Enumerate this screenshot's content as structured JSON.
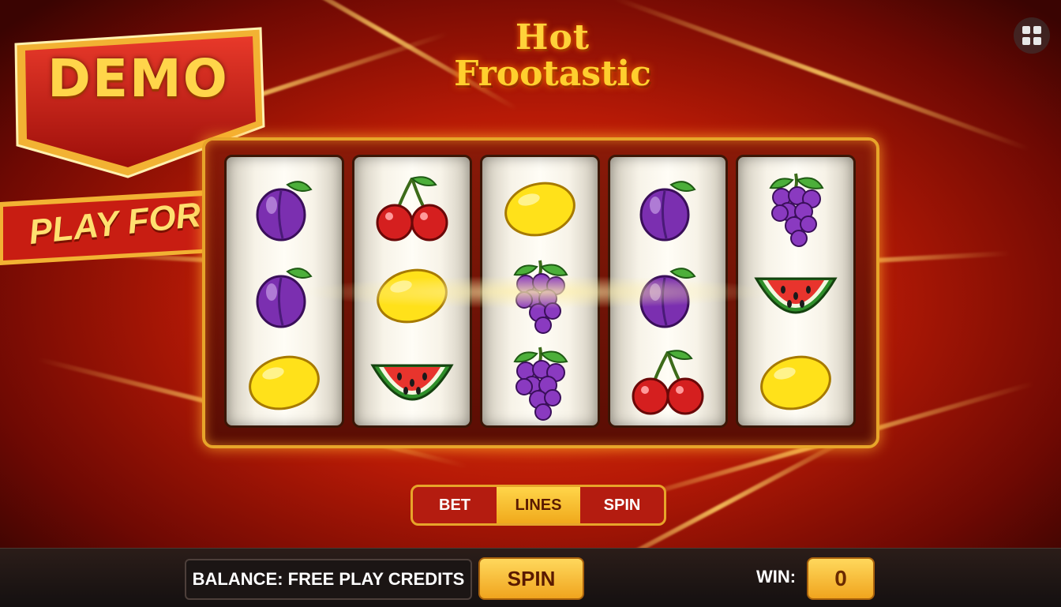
{
  "game": {
    "logo_line1": "Hot",
    "logo_line2": "Frootastic"
  },
  "badge": {
    "demo": "DEMO",
    "play_for_free": "PLAY FOR FREE"
  },
  "reels": [
    [
      "plum",
      "plum",
      "lemon"
    ],
    [
      "cherry",
      "lemon",
      "watermelon"
    ],
    [
      "lemon",
      "grape",
      "grape"
    ],
    [
      "plum",
      "plum",
      "cherry"
    ],
    [
      "grape",
      "watermelon",
      "lemon"
    ]
  ],
  "controls": {
    "bet": "BET",
    "lines": "LINES",
    "spin": "SPIN"
  },
  "bottom_bar": {
    "balance": "BALANCE: FREE PLAY CREDITS",
    "spin_button": "SPIN",
    "win_label": "WIN:",
    "win_value": "0"
  },
  "icons": {
    "menu": "grid-menu-icon"
  },
  "colors": {
    "gold": "#f0a41e",
    "red": "#b41c10"
  }
}
